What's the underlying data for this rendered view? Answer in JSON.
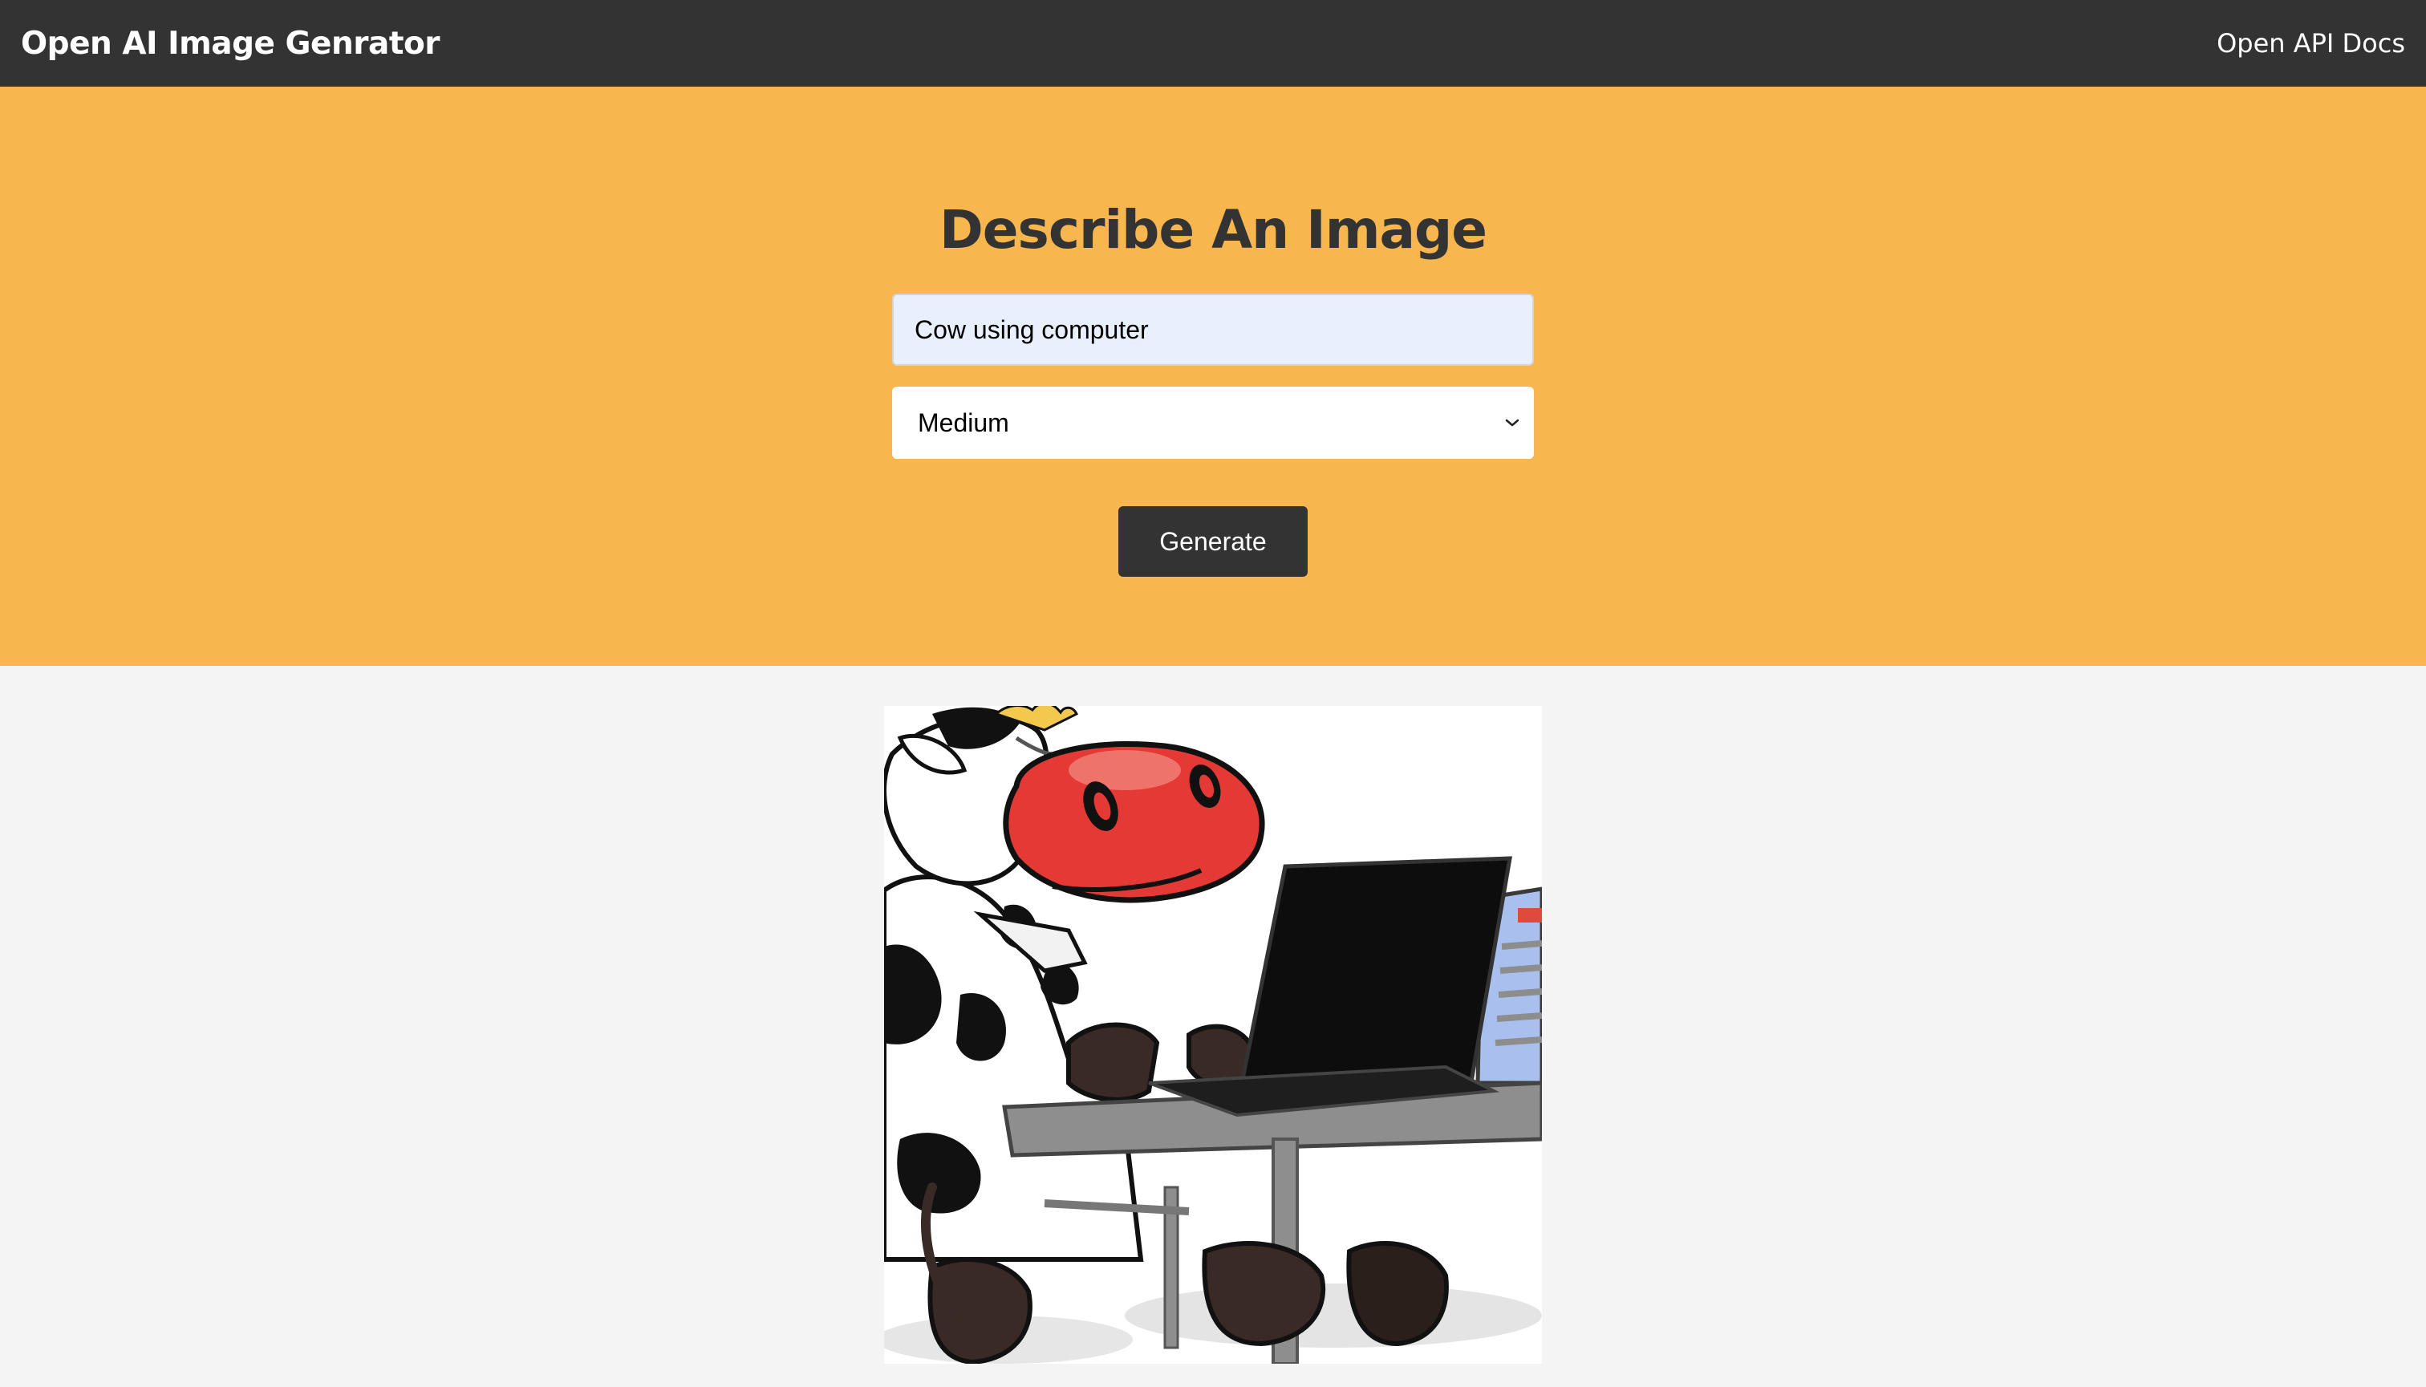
{
  "navbar": {
    "brand": "Open AI Image Genrator",
    "docs_link": "Open API Docs"
  },
  "form": {
    "title": "Describe An Image",
    "prompt_value": "Cow using computer",
    "size_selected": "Medium",
    "generate_label": "Generate"
  },
  "result": {
    "image_subject": "cartoon cow typing on a laptop at a desk"
  },
  "colors": {
    "navbar": "#333333",
    "hero": "#f8b74e",
    "page": "#f4f4f4",
    "button": "#333333",
    "input": "#e8f0fe"
  }
}
